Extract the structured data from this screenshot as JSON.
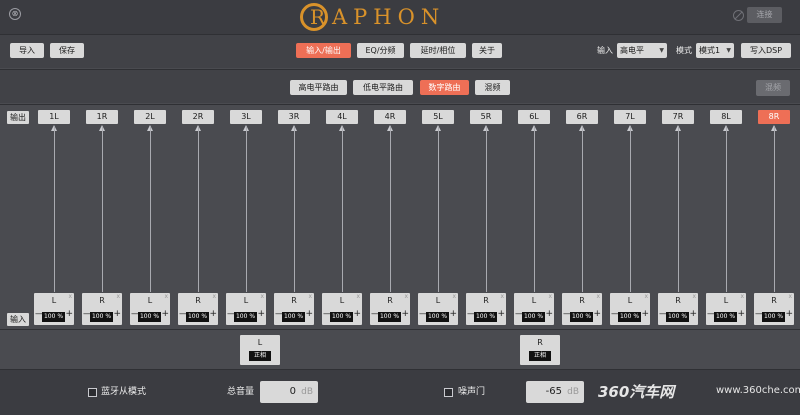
{
  "header": {
    "close_glyph": "⊗",
    "logo_letter": "R",
    "logo_text": "APHON",
    "connect_label": "连接"
  },
  "toolbar": {
    "import_label": "导入",
    "save_label": "保存",
    "tabs": [
      {
        "label": "输入/输出",
        "active": true
      },
      {
        "label": "EQ/分频",
        "active": false
      },
      {
        "label": "延时/相位",
        "active": false
      },
      {
        "label": "关于",
        "active": false
      }
    ],
    "input_label": "输入",
    "input_value": "高电平",
    "mode_label": "模式",
    "mode_value": "模式1",
    "write_label": "写入DSP"
  },
  "routing": {
    "tabs": [
      {
        "label": "高电平路由",
        "active": false
      },
      {
        "label": "低电平路由",
        "active": false
      },
      {
        "label": "数字路由",
        "active": true
      },
      {
        "label": "混频",
        "active": false
      }
    ],
    "mix_label": "混频"
  },
  "matrix": {
    "output_tag": "输出",
    "input_tag": "输入",
    "outputs": [
      {
        "label": "1L",
        "active": false
      },
      {
        "label": "1R",
        "active": false
      },
      {
        "label": "2L",
        "active": false
      },
      {
        "label": "2R",
        "active": false
      },
      {
        "label": "3L",
        "active": false
      },
      {
        "label": "3R",
        "active": false
      },
      {
        "label": "4L",
        "active": false
      },
      {
        "label": "4R",
        "active": false
      },
      {
        "label": "5L",
        "active": false
      },
      {
        "label": "5R",
        "active": false
      },
      {
        "label": "6L",
        "active": false
      },
      {
        "label": "6R",
        "active": false
      },
      {
        "label": "7L",
        "active": false
      },
      {
        "label": "7R",
        "active": false
      },
      {
        "label": "8L",
        "active": false
      },
      {
        "label": "8R",
        "active": true
      }
    ],
    "inputs": [
      {
        "channel": "L",
        "value": "100 %"
      },
      {
        "channel": "R",
        "value": "100 %"
      },
      {
        "channel": "L",
        "value": "100 %"
      },
      {
        "channel": "R",
        "value": "100 %"
      },
      {
        "channel": "L",
        "value": "100 %"
      },
      {
        "channel": "R",
        "value": "100 %"
      },
      {
        "channel": "L",
        "value": "100 %"
      },
      {
        "channel": "R",
        "value": "100 %"
      },
      {
        "channel": "L",
        "value": "100 %"
      },
      {
        "channel": "R",
        "value": "100 %"
      },
      {
        "channel": "L",
        "value": "100 %"
      },
      {
        "channel": "R",
        "value": "100 %"
      },
      {
        "channel": "L",
        "value": "100 %"
      },
      {
        "channel": "R",
        "value": "100 %"
      },
      {
        "channel": "L",
        "value": "100 %"
      },
      {
        "channel": "R",
        "value": "100 %"
      }
    ],
    "minus": "—",
    "plus": "+",
    "remove": "x"
  },
  "phase": [
    {
      "channel": "L",
      "state": "正相"
    },
    {
      "channel": "R",
      "state": "正相"
    }
  ],
  "bottom": {
    "bt_label": "蓝牙从模式",
    "volume_label": "总音量",
    "volume_value": "0",
    "volume_unit": "dB",
    "noise_label": "噪声门",
    "noise_value": "-65",
    "noise_unit": "dB",
    "watermark": "360汽车网",
    "watermark_url": "www.360che.com"
  }
}
